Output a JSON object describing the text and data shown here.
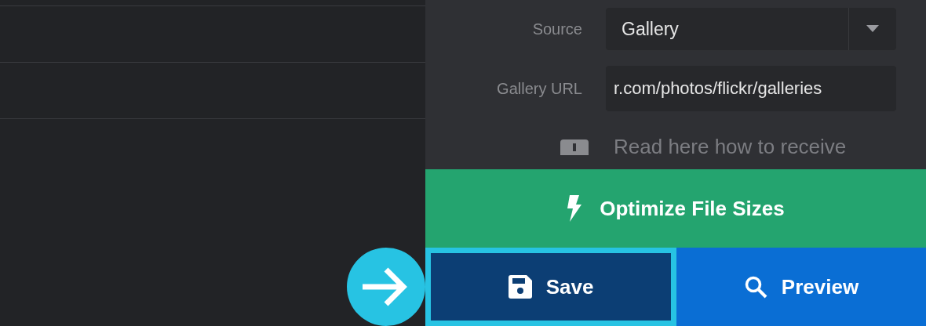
{
  "form": {
    "source": {
      "label": "Source",
      "value": "Gallery"
    },
    "gallery_url": {
      "label": "Gallery URL",
      "value": "r.com/photos/flickr/galleries"
    },
    "note": "Read here how to receive"
  },
  "optimize_button": {
    "label": "Optimize File Sizes"
  },
  "buttons": [
    {
      "kind": "save",
      "label": "Save",
      "highlighted": true
    },
    {
      "kind": "preview",
      "label": "Preview",
      "highlighted": false
    }
  ]
}
